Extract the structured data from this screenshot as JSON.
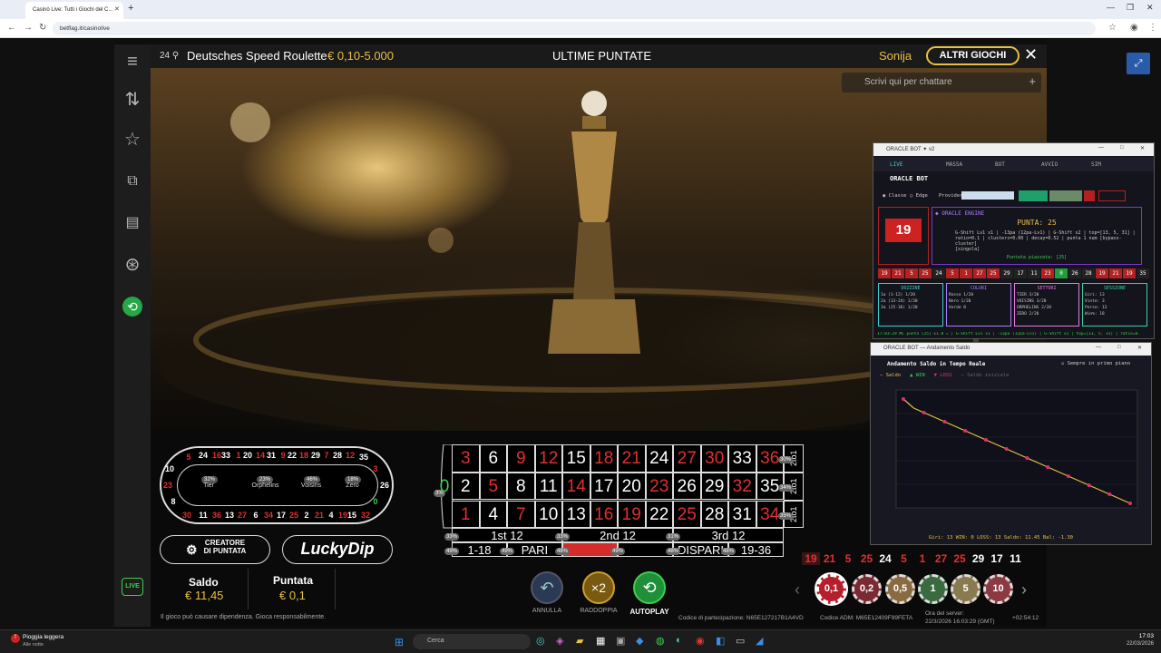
{
  "browser": {
    "tab_title": "Casinò Live: Tutti i Giochi del C...",
    "url": "betflag.it/casinolive"
  },
  "topbar": {
    "players": "24",
    "game_title": "Deutsches Speed Roulette",
    "limits": "€ 0,10-5.000",
    "center": "ULTIME PUNTATE",
    "user": "Sonija",
    "other_games": "ALTRI GIOCHI",
    "chat_placeholder": "Scrivi qui per chattare"
  },
  "racetrack": {
    "top": [
      "5",
      "24",
      "16",
      "33",
      "1",
      "20",
      "14",
      "31",
      "9",
      "22",
      "18",
      "29",
      "7",
      "28",
      "12",
      "35"
    ],
    "bottom": [
      "30",
      "8",
      "23",
      "10",
      "5",
      "24",
      "16",
      "33",
      "1",
      "20",
      "14",
      "31",
      "9",
      "22",
      "18",
      "29",
      "7",
      "28",
      "12",
      "35"
    ],
    "bottom_row": [
      "30",
      "11",
      "36",
      "13",
      "27",
      "6",
      "34",
      "17",
      "25",
      "2",
      "21",
      "4",
      "19",
      "15",
      "32"
    ],
    "left": [
      "10",
      "23",
      "8"
    ],
    "right": [
      "3",
      "26",
      "0"
    ],
    "sections": [
      {
        "label": "Tier",
        "pct": "32%"
      },
      {
        "label": "Orphelins",
        "pct": "23%"
      },
      {
        "label": "Voisins",
        "pct": "46%"
      },
      {
        "label": "Zero",
        "pct": "18%"
      }
    ]
  },
  "buttons": {
    "creator": "CREATORE DI PUNTATA",
    "luckydip": "LuckyDip",
    "undo": "ANNULLA",
    "double": "RADDOPPIA",
    "autoplay": "AUTOPLAY"
  },
  "balance": {
    "saldo_label": "Saldo",
    "saldo": "€ 11,45",
    "bet_label": "Puntata",
    "bet": "€ 0,1"
  },
  "disclaimer": "Il gioco può causare dipendenza. Gioca responsabilmente.",
  "table": {
    "zero": "0",
    "zero_pct": "3%",
    "row1": [
      "3",
      "6",
      "9",
      "12",
      "15",
      "18",
      "21",
      "24",
      "27",
      "30",
      "33",
      "36"
    ],
    "row2": [
      "2",
      "5",
      "8",
      "11",
      "14",
      "17",
      "20",
      "23",
      "26",
      "29",
      "32",
      "35"
    ],
    "row3": [
      "1",
      "4",
      "7",
      "10",
      "13",
      "16",
      "19",
      "22",
      "25",
      "28",
      "31",
      "34"
    ],
    "col_label": "2to1",
    "col_pcts": [
      "30%",
      "34%",
      "35%"
    ],
    "dozens": [
      "1st 12",
      "2nd 12",
      "3rd 12"
    ],
    "dozen_pcts": [
      "33%",
      "33%",
      "31%"
    ],
    "outside": [
      "1-18",
      "PARI",
      "",
      "",
      "DISPARI",
      "19-36"
    ],
    "outside_pcts": [
      "49%",
      "49%",
      "48%",
      "49%",
      "48%",
      "48%"
    ]
  },
  "history": [
    "19",
    "21",
    "5",
    "25",
    "24",
    "5",
    "1",
    "27",
    "25",
    "29",
    "17",
    "11"
  ],
  "chips": [
    "0,1",
    "0,2",
    "0,5",
    "1",
    "5",
    "10"
  ],
  "codes": {
    "participation": "Codice di partecipazione: N65E127217B1A4VD",
    "adm": "Codice ADM: M65E12409F99FETA",
    "server_label": "Ora del server:",
    "server_time": "22/3/2026 16:03:29 (GMT)",
    "session": "+02:54:12"
  },
  "bot": {
    "window_title": "ORACLE BOT",
    "version": "v2",
    "tabs": [
      "LIVE",
      "MASSA",
      "BOT",
      "AVVIO",
      "SIM"
    ],
    "app_name": "ORACLE BOT",
    "mode_classic": "Classe",
    "mode_edge": "Edge",
    "provider_label": "Provider:",
    "engine_title": "ORACLE ENGINE",
    "bet_label": "PUNTA: 25",
    "last_number": "19",
    "engine_lines": [
      "G-Shift Lv1 x1 | -13pa (12pa-Lv1) | G-Shift x2 | top=[13, 5, 31] |",
      "ratio=0.1 | clusters=0.00 | decay=0.52 | punta 1 num [bypass-cluster]",
      "[singola]"
    ],
    "placed": "Puntata piazzata: [25]",
    "history": [
      "19",
      "21",
      "5",
      "25",
      "24",
      "5",
      "1",
      "27",
      "25",
      "29",
      "17",
      "11",
      "23",
      "0",
      "26",
      "28",
      "19",
      "21",
      "19",
      "35"
    ],
    "boxes": [
      {
        "title": "DOZZINE",
        "lines": [
          "1a (1-12)  1/20",
          "2a (13-24) 1/20",
          "3a (25-36) 1/20"
        ]
      },
      {
        "title": "COLORI",
        "lines": [
          "Rosso  1/20",
          "Nero   1/20",
          "Verde  0"
        ]
      },
      {
        "title": "SETTORI",
        "lines": [
          "TIER     3/20",
          "VOISINS  3/20",
          "ORPHELINS 2/20",
          "ZERO     2/20"
        ]
      },
      {
        "title": "SESSIONE",
        "lines": [
          "Giri: 13",
          "Vinte: 3",
          "Perse: 13",
          "Win%: 18"
        ]
      }
    ],
    "status": "17:03:29  ML punta [25] x1.0 = | G-Shift Lv1 x1 | -13pa (12pa-Lv1) | G-Shift x2 | top=[13, 5, 31] | ratio=0.1"
  },
  "saldo_window": {
    "title": "ORACLE BOT — Andamento Saldo",
    "heading": "Andamento Saldo in Tempo Reale",
    "pin": "Sempre in primo piano",
    "legend": [
      "Saldo",
      "WIN",
      "LOSS",
      "Saldo iniziale"
    ],
    "values": [
      12.6,
      12.5,
      12.45,
      12.4,
      12.35,
      12.3,
      12.25,
      12.2,
      12.15,
      12.1,
      12.05,
      12.0,
      11.95,
      11.9,
      11.85,
      11.8,
      11.75,
      11.7,
      11.65,
      11.6,
      11.55,
      11.5,
      11.45
    ],
    "stats": "Giri: 13   WIN: 0   LOSS: 13   Saldo: 11.45   Bal: -1.30"
  },
  "taskbar": {
    "weather": "Pioggia leggera",
    "weather_sub": "Alle notte",
    "search": "Cerca",
    "time": "17:03",
    "date": "22/03/2026"
  }
}
